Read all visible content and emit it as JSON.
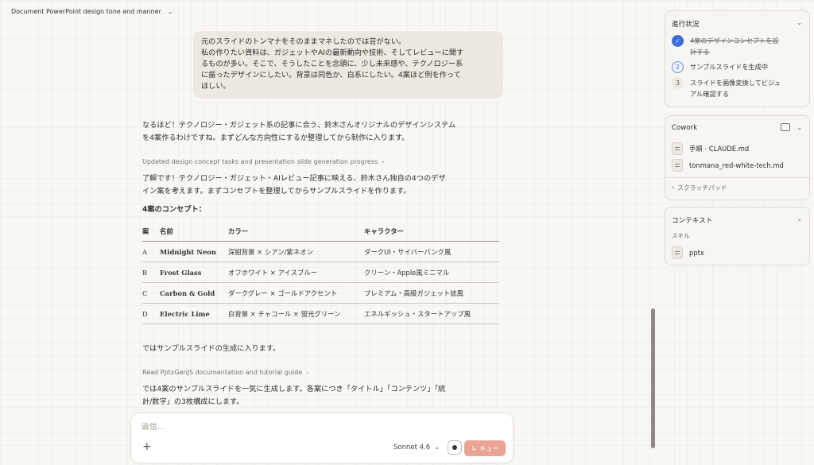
{
  "header": {
    "title": "Document PowerPoint design tone and manner"
  },
  "user_message": {
    "line1": "元のスライドのトンマナをそのままマネしたのでは芸がない。",
    "line2": "私の作りたい資料は、ガジェットやAIの最新動向や技術、そしてレビューに関す",
    "line3": "るものが多い。そこで、そうしたことを念頭に、少し未来感や、テクノロジー系",
    "line4": "に振ったデザインにしたい。背景は同色か、白系にしたい。4案ほど例を作って",
    "line5": "ほしい。"
  },
  "assistant": {
    "para1_line1": "なるほど！テクノロジー・ガジェット系の記事に合う、鈴木さんオリジナルのデザインシステム",
    "para1_line2": "を4案作るわけですね。まずどんな方向性にするか整理してから制作に入ります。",
    "tool1": "Updated design concept tasks and presentation slide generation progress",
    "para2_line1": "了解です！テクノロジー・ガジェット・AIレビュー記事に映える、鈴木さん独自の4つのデザ",
    "para2_line2": "イン案を考えます。まずコンセプトを整理してからサンプルスライドを作ります。",
    "concepts_heading": "4案のコンセプト：",
    "table": {
      "headers": [
        "案",
        "名前",
        "カラー",
        "キャラクター"
      ],
      "rows": [
        [
          "A",
          "Midnight Neon",
          "深紺背景 × シアン/紫ネオン",
          "ダークUI・サイバーパンク風"
        ],
        [
          "B",
          "Frost Glass",
          "オフホワイト × アイスブルー",
          "クリーン・Apple風ミニマル"
        ],
        [
          "C",
          "Carbon & Gold",
          "ダークグレー × ゴールドアクセント",
          "プレミアム・高級ガジェット誌風"
        ],
        [
          "D",
          "Electric Lime",
          "白背景 × チャコール × 蛍光グリーン",
          "エネルギッシュ・スタートアップ風"
        ]
      ]
    },
    "para3": "ではサンプルスライドの生成に入ります。",
    "tool2": "Read PptxGenJS documentation and tutorial guide",
    "para4_line1": "では4案のサンプルスライドを一気に生成します。各案につき「タイトル」「コンテンツ」「統",
    "para4_line2": "計/数字」の3枚構成にします。"
  },
  "composer": {
    "placeholder": "返信...",
    "model": "Sonnet 4.6",
    "queue_label": "キュー"
  },
  "progress_panel": {
    "title": "進行状況",
    "steps": [
      {
        "num": "✓",
        "line1": "4案のデザインコンセプトを設",
        "line2": "計する",
        "status": "done"
      },
      {
        "num": "2",
        "line1": "サンプルスライドを生成中",
        "line2": "",
        "status": "active"
      },
      {
        "num": "3",
        "line1": "スライドを画像変換してビジュ",
        "line2": "アル確認する",
        "status": "todo"
      }
    ]
  },
  "cowork_panel": {
    "title": "Cowork",
    "files": [
      "手順 · CLAUDE.md",
      "tonmana_red-white-tech.md"
    ],
    "scratchpad": "スクラッチパッド"
  },
  "context_panel": {
    "title": "コンテキスト",
    "skills_label": "スキル",
    "skill": "pptx"
  },
  "colors": {
    "accent_blue": "#3b6fd8",
    "queue_button": "#e8a593",
    "background": "#f9f8f4"
  }
}
